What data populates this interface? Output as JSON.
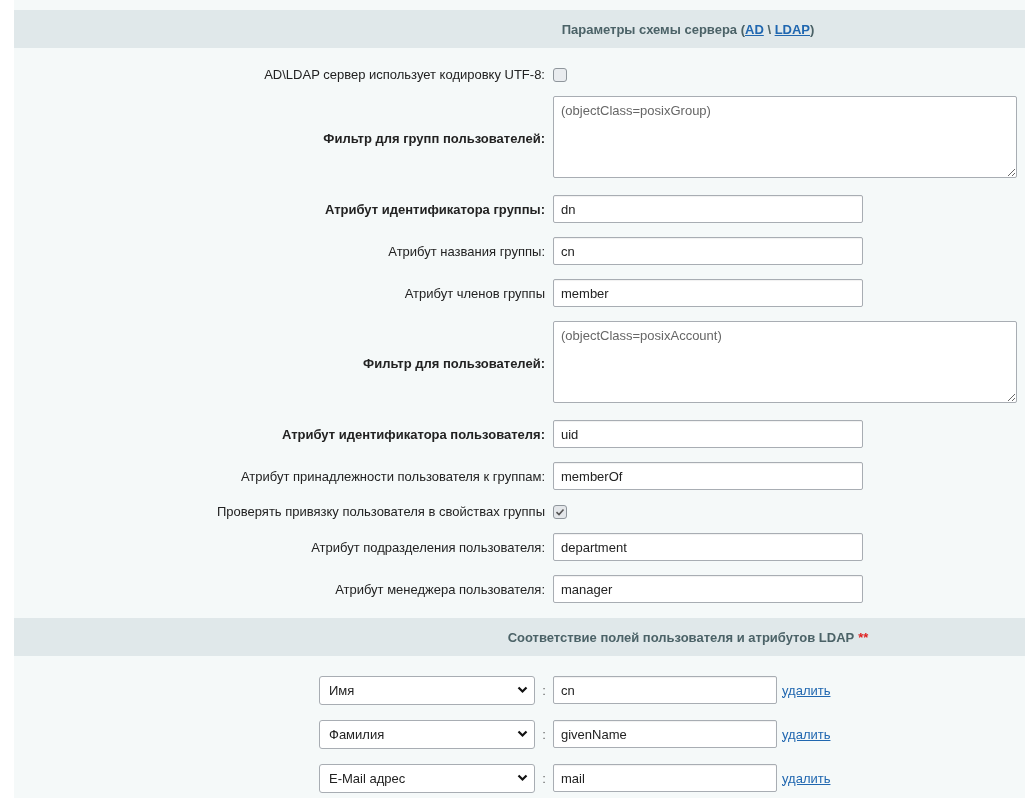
{
  "schema_section": {
    "title": "Параметры схемы сервера (",
    "links": [
      "AD",
      "LDAP"
    ],
    "separator": " \\ ",
    "title_end": ")"
  },
  "fields": [
    {
      "kind": "checkbox",
      "label": "AD\\LDAP сервер использует кодировку UTF-8:",
      "bold": false,
      "checked": false
    },
    {
      "kind": "textarea",
      "label": "Фильтр для групп пользователей:",
      "bold": true,
      "value": "(objectClass=posixGroup)"
    },
    {
      "kind": "text",
      "label": "Атрибут идентификатора группы:",
      "bold": true,
      "value": "dn"
    },
    {
      "kind": "text",
      "label": "Атрибут названия группы:",
      "bold": false,
      "value": "cn"
    },
    {
      "kind": "text",
      "label": "Атрибут членов группы",
      "bold": false,
      "value": "member"
    },
    {
      "kind": "textarea",
      "label": "Фильтр для пользователей:",
      "bold": true,
      "value": "(objectClass=posixAccount)"
    },
    {
      "kind": "text",
      "label": "Атрибут идентификатора пользователя:",
      "bold": true,
      "value": "uid"
    },
    {
      "kind": "text",
      "label": "Атрибут принадлежности пользователя к группам:",
      "bold": false,
      "value": "memberOf"
    },
    {
      "kind": "checkbox",
      "label": "Проверять привязку пользователя в свойствах группы",
      "bold": false,
      "checked": true
    },
    {
      "kind": "text",
      "label": "Атрибут подразделения пользователя:",
      "bold": false,
      "value": "department"
    },
    {
      "kind": "text",
      "label": "Атрибут менеджера пользователя:",
      "bold": false,
      "value": "manager"
    }
  ],
  "mapping_section": {
    "title": "Соответствие полей пользователя и атрибутов LDAP",
    "required_mark": "**"
  },
  "mappings": [
    {
      "field": "Имя",
      "separator": ":",
      "attribute": "cn",
      "action": "удалить"
    },
    {
      "field": "Фамилия",
      "separator": ":",
      "attribute": "givenName",
      "action": "удалить"
    },
    {
      "field": "E-Mail адрес",
      "separator": ":",
      "attribute": "mail",
      "action": "удалить"
    }
  ]
}
